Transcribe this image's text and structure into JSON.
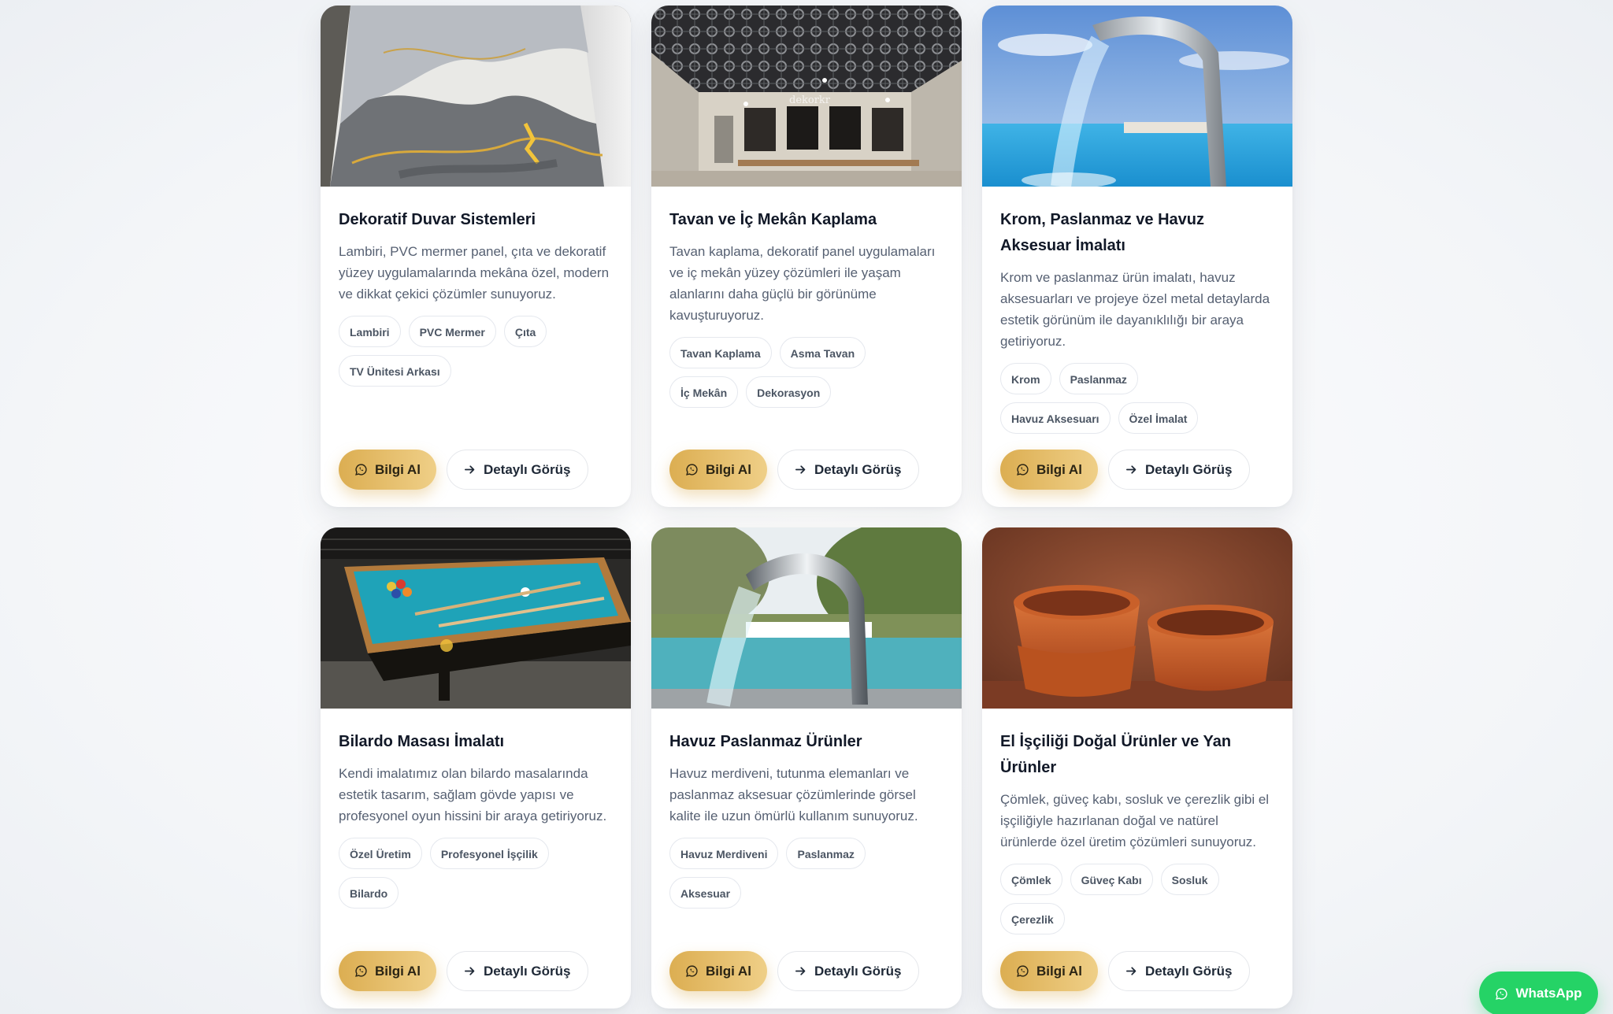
{
  "cards": [
    {
      "title": "Dekoratif Duvar Sistemleri",
      "description": "Lambiri, PVC mermer panel, çıta ve dekoratif yüzey uygulamalarında mekâna özel, modern ve dikkat çekici çözümler sunuyoruz.",
      "tags": [
        "Lambiri",
        "PVC Mermer",
        "Çıta",
        "TV Ünitesi Arkası"
      ],
      "info_label": "Bilgi Al",
      "detail_label": "Detaylı Görüş"
    },
    {
      "title": "Tavan ve İç Mekân Kaplama",
      "description": "Tavan kaplama, dekoratif panel uygulamaları ve iç mekân yüzey çözümleri ile yaşam alanlarını daha güçlü bir görünüme kavuşturuyoruz.",
      "tags": [
        "Tavan Kaplama",
        "Asma Tavan",
        "İç Mekân",
        "Dekorasyon"
      ],
      "info_label": "Bilgi Al",
      "detail_label": "Detaylı Görüş"
    },
    {
      "title": "Krom, Paslanmaz ve Havuz Aksesuar İmalatı",
      "description": "Krom ve paslanmaz ürün imalatı, havuz aksesuarları ve projeye özel metal detaylarda estetik görünüm ile dayanıklılığı bir araya getiriyoruz.",
      "tags": [
        "Krom",
        "Paslanmaz",
        "Havuz Aksesuarı",
        "Özel İmalat"
      ],
      "info_label": "Bilgi Al",
      "detail_label": "Detaylı Görüş"
    },
    {
      "title": "Bilardo Masası İmalatı",
      "description": "Kendi imalatımız olan bilardo masalarında estetik tasarım, sağlam gövde yapısı ve profesyonel oyun hissini bir araya getiriyoruz.",
      "tags": [
        "Özel Üretim",
        "Profesyonel İşçilik",
        "Bilardo"
      ],
      "info_label": "Bilgi Al",
      "detail_label": "Detaylı Görüş"
    },
    {
      "title": "Havuz Paslanmaz Ürünler",
      "description": "Havuz merdiveni, tutunma elemanları ve paslanmaz aksesuar çözümlerinde görsel kalite ile uzun ömürlü kullanım sunuyoruz.",
      "tags": [
        "Havuz Merdiveni",
        "Paslanmaz",
        "Aksesuar"
      ],
      "info_label": "Bilgi Al",
      "detail_label": "Detaylı Görüş"
    },
    {
      "title": "El İşçiliği Doğal Ürünler ve Yan Ürünler",
      "description": "Çömlek, güveç kabı, sosluk ve çerezlik gibi el işçiliğiyle hazırlanan doğal ve natürel ürünlerde özel üretim çözümleri sunuyoruz.",
      "tags": [
        "Çömlek",
        "Güveç Kabı",
        "Sosluk",
        "Çerezlik"
      ],
      "info_label": "Bilgi Al",
      "detail_label": "Detaylı Görüş"
    }
  ],
  "image_watermark": "dekorkr",
  "whatsapp_label": "WhatsApp",
  "colors": {
    "accent_gold": "#dcae52",
    "whatsapp_green": "#25d366",
    "title": "#111827",
    "text": "#566072"
  },
  "icons": {
    "info_button": "whatsapp-icon",
    "detail_button": "arrow-right-icon",
    "floating_button": "whatsapp-icon"
  }
}
